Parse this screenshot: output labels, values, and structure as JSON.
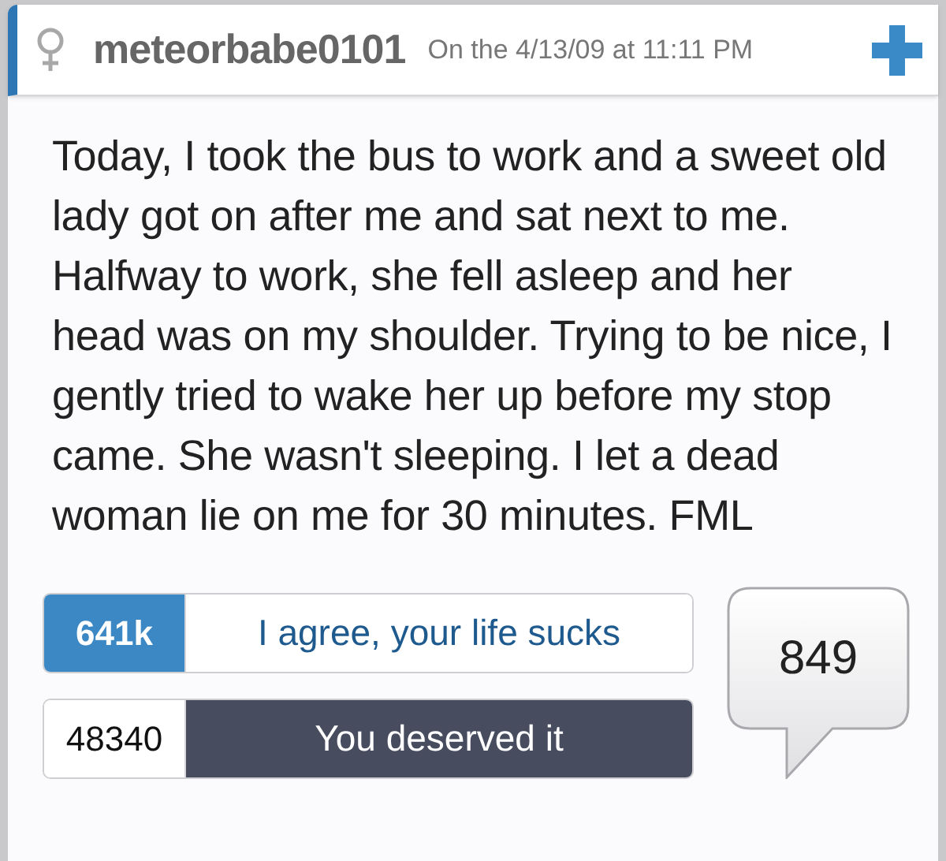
{
  "post": {
    "author": "meteorbabe0101",
    "date": "On the 4/13/09 at 11:11 PM",
    "text": "Today, I took the bus to work and a sweet old lady got on after me and sat next to me. Halfway to work, she fell asleep and her head was on my shoulder. Trying to be nice, I gently tried to wake her up before my stop came. She wasn't sleeping. I let a dead woman lie on me for 30 minutes. FML"
  },
  "votes": [
    {
      "kind": "agree",
      "count": "641k",
      "label": "I agree, your life sucks"
    },
    {
      "kind": "deserved",
      "count": "48340",
      "label": "You deserved it"
    }
  ],
  "comments": {
    "count": "849"
  }
}
